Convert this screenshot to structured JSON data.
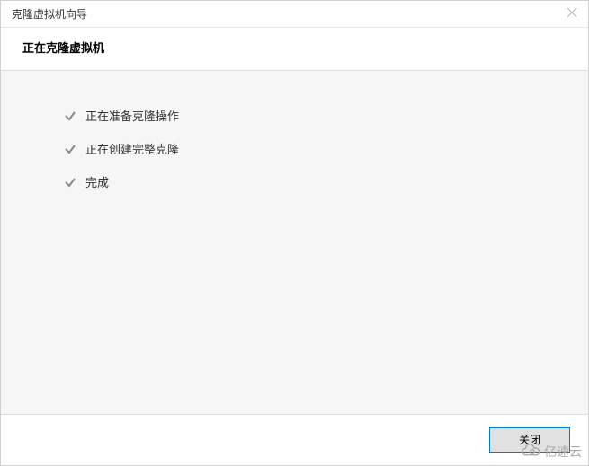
{
  "titlebar": {
    "title": "克隆虚拟机向导"
  },
  "header": {
    "title": "正在克隆虚拟机"
  },
  "progress": {
    "items": [
      {
        "label": "正在准备克隆操作"
      },
      {
        "label": "正在创建完整克隆"
      },
      {
        "label": "完成"
      }
    ]
  },
  "footer": {
    "close_label": "关闭"
  },
  "watermark": {
    "text": "亿速云"
  }
}
